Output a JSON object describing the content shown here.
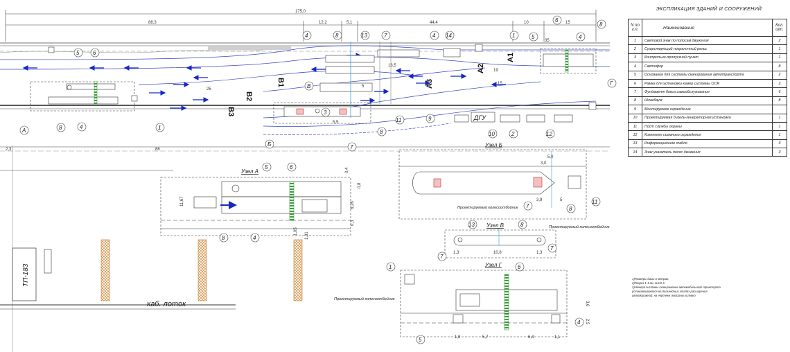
{
  "legend": {
    "title": "ЭКСПЛИКАЦИЯ ЗДАНИЙ И СООРУЖЕНИЙ",
    "col_num": "N по г.п.",
    "col_name": "Наименование",
    "col_qty": "Кол. шт.",
    "rows": [
      {
        "n": "1",
        "name": "Световой знак по полосам движения",
        "qty": "2"
      },
      {
        "n": "2",
        "name": "Существующий пограничный рельс",
        "qty": "1"
      },
      {
        "n": "3",
        "name": "Контрольно-пропускной пункт",
        "qty": "1"
      },
      {
        "n": "4",
        "name": "Светофор",
        "qty": "8"
      },
      {
        "n": "5",
        "name": "Основание для системы сканирования автотранспорта",
        "qty": "2"
      },
      {
        "n": "6",
        "name": "Рамка для установки камер системы OCR",
        "qty": "2"
      },
      {
        "n": "7",
        "name": "Фундамент бокса самообслуживания",
        "qty": "6"
      },
      {
        "n": "8",
        "name": "Шлагбаум",
        "qty": "8"
      },
      {
        "n": "9",
        "name": "Монтируемое ограждение",
        "qty": ""
      },
      {
        "n": "10",
        "name": "Проектируемая дизель-генераторная установка",
        "qty": "1"
      },
      {
        "n": "11",
        "name": "Пост службы охраны",
        "qty": "1"
      },
      {
        "n": "12",
        "name": "Комплект съемного ограждения",
        "qty": "1"
      },
      {
        "n": "13",
        "name": "Информационное табло",
        "qty": "3"
      },
      {
        "n": "14",
        "name": "Знак указатель полос движения",
        "qty": "3"
      }
    ]
  },
  "plan": {
    "dims_top": {
      "total": "175,0",
      "d1": "88,3",
      "d2": "12,2",
      "d3": "5,1",
      "d4": "44,4",
      "d5": "10",
      "d6": "15"
    },
    "dim_bottom": "86",
    "dim_left": "2,3",
    "dims_misc": {
      "d25": "25",
      "d35": "35",
      "d19": "19",
      "d15": "15",
      "d5": "5",
      "d55": "5,5",
      "d135": "13,5"
    },
    "lanes": {
      "a1": "A1",
      "a2": "A2",
      "a3": "A3",
      "b1": "B1",
      "b2": "B2",
      "b3": "B3"
    },
    "node_callouts": {
      "a": "А",
      "b": "Б",
      "v": "В",
      "g": "Г"
    },
    "dgu_label": "ДГУ",
    "tp_label": "ТП-183",
    "cable_label": "каб. лоток"
  },
  "details": {
    "a": {
      "title": "Узел А",
      "dims": {
        "d1": "0,4",
        "d2": "11,67",
        "d3": "0,8",
        "d4": "6,26",
        "d5": "0,3",
        "d6": "1,05",
        "d7": "1,31"
      }
    },
    "b": {
      "title": "Узел Б",
      "dims": {
        "d1": "5,0",
        "d2": "3,0",
        "d3": "3,9",
        "d4": "5"
      },
      "proj": "Проектируемый колесоотбойник"
    },
    "v": {
      "title": "Узел В",
      "dims": {
        "d1": "10,8",
        "d2": "1,3",
        "d3": "1,3"
      },
      "proj": "Проектируемый колесоотбойник"
    },
    "g": {
      "title": "Узел Г",
      "dims": {
        "d1": "1,8",
        "d2": "5,7",
        "d3": "6,4",
        "d4": "1,1",
        "d5": "3,6",
        "d6": "2,5"
      },
      "proj": "Проектируемый колесоотбойник"
    }
  },
  "notes": [
    "1)Размеры даны в метрах.",
    "2)Разрез 1-1 см. лист 6.",
    "3)Номера системы сканирования автомобильного транспорта",
    "устанавливаются на дальнейших этапах расширения",
    "автодорожной, на чертеже показаны условно"
  ]
}
